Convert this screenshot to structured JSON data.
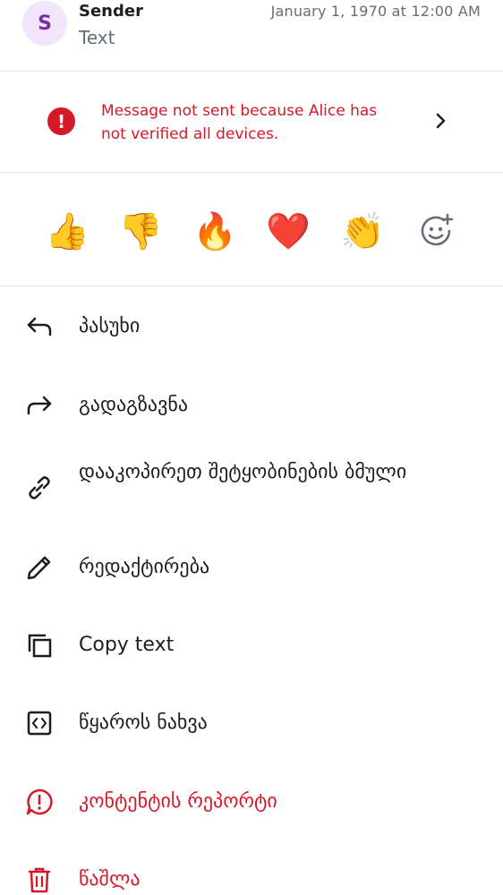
{
  "message": {
    "avatar_letter": "S",
    "sender": "Sender",
    "preview": "Text",
    "timestamp": "January 1, 1970 at 12:00 AM"
  },
  "warning": {
    "text": "Message not sent because Alice has not verified all devices.",
    "color": "#d51928"
  },
  "reactions": [
    {
      "emoji": "👍",
      "name": "thumbs-up"
    },
    {
      "emoji": "👎",
      "name": "thumbs-down"
    },
    {
      "emoji": "🔥",
      "name": "fire"
    },
    {
      "emoji": "❤️",
      "name": "red-heart"
    },
    {
      "emoji": "👏",
      "name": "clapping-hands"
    }
  ],
  "add_reaction_icon": "add-emoji-icon",
  "menu": [
    {
      "label": "პასუხი",
      "icon": "reply-icon"
    },
    {
      "label": "გადაგზავნა",
      "icon": "forward-icon"
    },
    {
      "label": "დააკოპირეთ შეტყობინების ბმული",
      "icon": "link-icon"
    },
    {
      "label": "რედაქტირება",
      "icon": "edit-icon"
    },
    {
      "label": "Copy text",
      "icon": "copy-icon"
    },
    {
      "label": "წყაროს ნახვა",
      "icon": "view-source-icon"
    },
    {
      "label": "კონტენტის რეპორტი",
      "icon": "report-icon"
    },
    {
      "label": "წაშლა",
      "icon": "delete-icon"
    }
  ],
  "colors": {
    "accent_red": "#d51928",
    "avatar_bg": "#f3e5fa",
    "avatar_fg": "#7a2ea8",
    "secondary_text": "#656d77"
  }
}
